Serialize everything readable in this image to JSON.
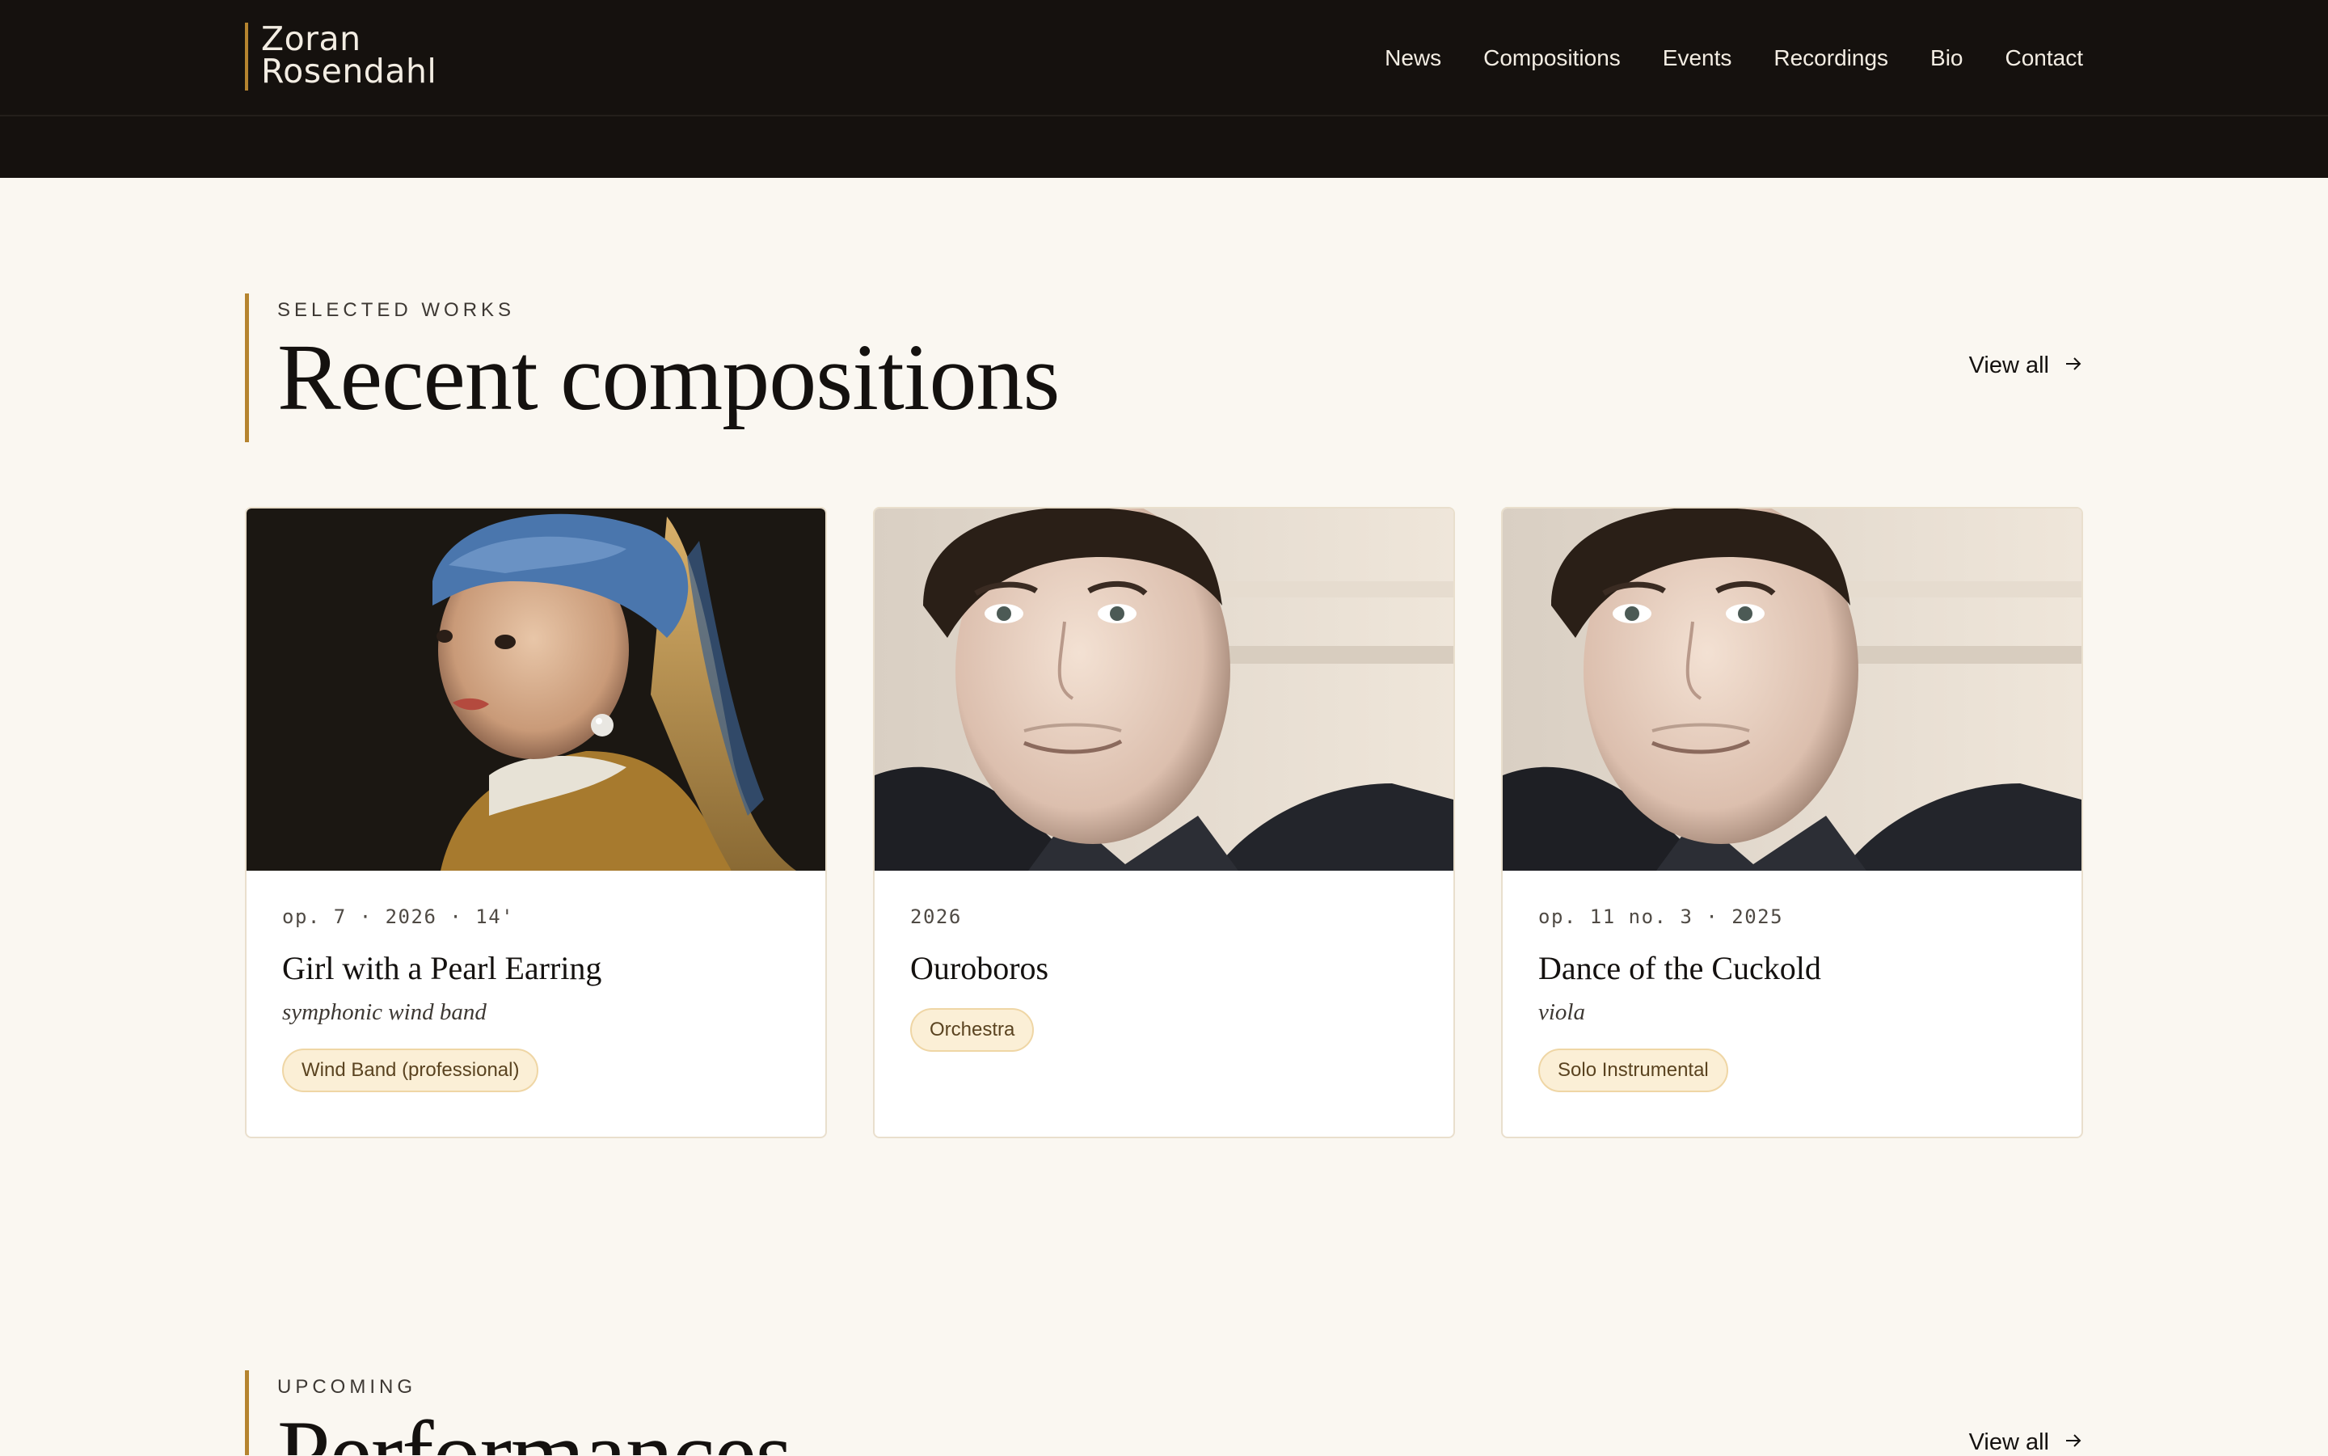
{
  "header": {
    "logo_line1": "Zoran",
    "logo_line2": "Rosendahl",
    "nav": [
      "News",
      "Compositions",
      "Events",
      "Recordings",
      "Bio",
      "Contact"
    ]
  },
  "works": {
    "eyebrow": "SELECTED WORKS",
    "title": "Recent compositions",
    "view_all": "View all",
    "cards": [
      {
        "meta": "op. 7 · 2026 · 14'",
        "title": "Girl with a Pearl Earring",
        "instrumentation": "symphonic wind band",
        "tag": "Wind Band (professional)",
        "image": "painting-girl-with-pearl-earring"
      },
      {
        "meta": "2026",
        "title": "Ouroboros",
        "instrumentation": "",
        "tag": "Orchestra",
        "image": "composer-portrait"
      },
      {
        "meta": "op. 11 no. 3 · 2025",
        "title": "Dance of the Cuckold",
        "instrumentation": "viola",
        "tag": "Solo Instrumental",
        "image": "composer-portrait"
      }
    ]
  },
  "performances": {
    "eyebrow": "UPCOMING",
    "title": "Performances",
    "view_all": "View all"
  },
  "colors": {
    "header_bg": "#15110e",
    "page_bg": "#faf7f1",
    "accent": "#b5842f",
    "tag_bg": "#fbefd6"
  }
}
